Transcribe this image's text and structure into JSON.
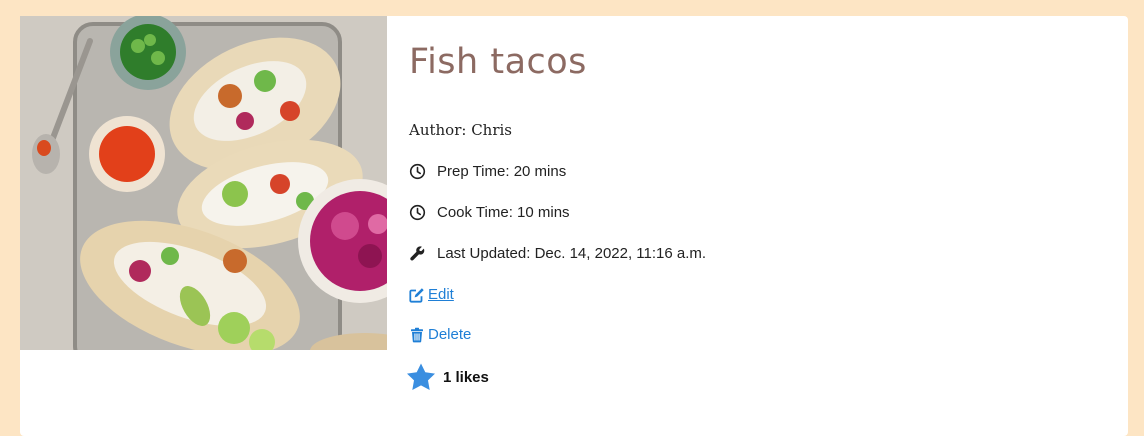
{
  "recipe": {
    "title": "Fish tacos",
    "author": "Author: Chris",
    "prep_time": "Prep Time: 20 mins",
    "cook_time": "Cook Time: 10 mins",
    "last_updated": "Last Updated: Dec. 14, 2022, 11:16 a.m."
  },
  "actions": {
    "edit_label": "Edit",
    "delete_label": "Delete"
  },
  "likes": {
    "label": "1 likes",
    "count": 1
  },
  "icons": {
    "prep": "clock-icon",
    "cook": "clock-icon",
    "updated": "wrench-icon",
    "edit": "edit-icon",
    "delete": "trash-icon",
    "like": "star-icon"
  },
  "colors": {
    "page_background": "#fde5c4",
    "card_background": "#ffffff",
    "title": "#8c6a62",
    "link": "#1f7fd6",
    "star": "#3a8ee0"
  }
}
